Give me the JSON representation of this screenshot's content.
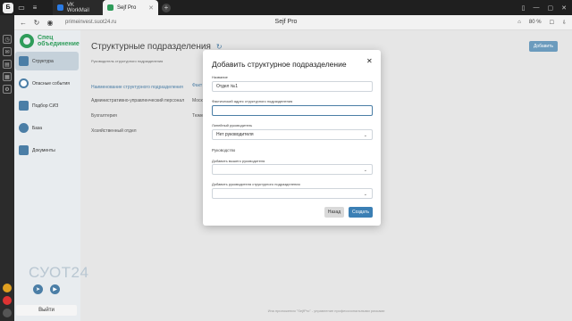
{
  "browser": {
    "tabs": [
      {
        "label": "VK WorkMail",
        "active": false
      },
      {
        "label": "Sejf Pro",
        "active": true
      }
    ],
    "url": "primeinvest.suot24.ru",
    "page_title": "Sejf Pro",
    "zoom": "80 %"
  },
  "sidebar": {
    "logo_line1": "Спец",
    "logo_line2": "объединение",
    "items": [
      {
        "label": "Структура",
        "icon": "structure-icon",
        "active": true
      },
      {
        "label": "Опасные события",
        "icon": "warning-icon",
        "active": false
      },
      {
        "label": "Подбор СИЗ",
        "icon": "ppe-icon",
        "active": false
      },
      {
        "label": "База",
        "icon": "database-icon",
        "active": false
      },
      {
        "label": "Документы",
        "icon": "documents-icon",
        "active": false
      }
    ],
    "brand": "СУОТ24",
    "logout_label": "Выйти"
  },
  "main": {
    "heading": "Структурные подразделения",
    "add_button": "Добавить",
    "filter_label": "Руководитель структурного подразделения",
    "table_header_name": "Наименование структурного подразделения",
    "table_header_addr": "Факт",
    "rows": [
      {
        "name": "Административно-управленческий персонал",
        "addr": "Моск"
      },
      {
        "name": "Бухгалтерия",
        "addr": "Тюме"
      },
      {
        "name": "Хозяйственный отдел",
        "addr": ""
      }
    ],
    "footer": "Ипа приложения \"SejfPro\" - управление профессиональными рисками"
  },
  "modal": {
    "title": "Добавить структурное подразделение",
    "name_label": "Название",
    "name_value": "Отдел №1",
    "address_label": "Фактический адрес структурного подразделения",
    "address_value": "",
    "line_manager_label": "Линейный руководитель",
    "line_manager_value": "Нет руководителя",
    "management_section": "Руководство",
    "senior_manager_label": "Добавить вышего руководителя",
    "dept_manager_label": "Добавить руководителя структурного подразделения",
    "back_label": "Назад",
    "create_label": "Создать"
  },
  "colors": {
    "accent": "#3b7fb4",
    "brand_green": "#2e9c5a",
    "sidebar_bg": "#e8ecef"
  }
}
